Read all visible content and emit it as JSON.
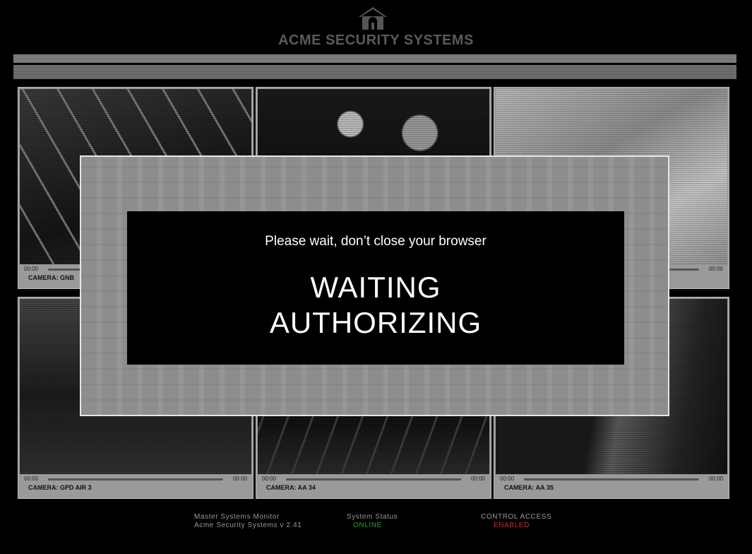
{
  "brand": {
    "title": "ACME SECURITY SYSTEMS",
    "logo": "house-lock-icon"
  },
  "cameras": [
    {
      "label": "CAMERA: GNB",
      "time_start": "00:00",
      "time_end": ""
    },
    {
      "label": "",
      "time_start": "",
      "time_end": ""
    },
    {
      "label": "",
      "time_start": "",
      "time_end": "00:00"
    },
    {
      "label": "CAMERA: GPD AIR 3",
      "time_start": "00:00",
      "time_end": "00:00"
    },
    {
      "label": "CAMERA: AA 34",
      "time_start": "00:00",
      "time_end": "00:00"
    },
    {
      "label": "CAMERA: AA 35",
      "time_start": "00:00",
      "time_end": "00:00"
    }
  ],
  "dialog": {
    "subtitle": "Please wait, don’t close your browser",
    "status_line1": "WAITING",
    "status_line2": "AUTHORIZING"
  },
  "footer": {
    "monitor_title": "Master Systems Monitor",
    "monitor_version": "Acme Security Systems v 2.41",
    "status_label": "System Status",
    "status_value": "ONLINE",
    "access_label": "CONTROL ACCESS",
    "access_value": "ENABLED"
  },
  "colors": {
    "online": "#2e9e2e",
    "enabled": "#d22a2a",
    "background": "#000000"
  }
}
